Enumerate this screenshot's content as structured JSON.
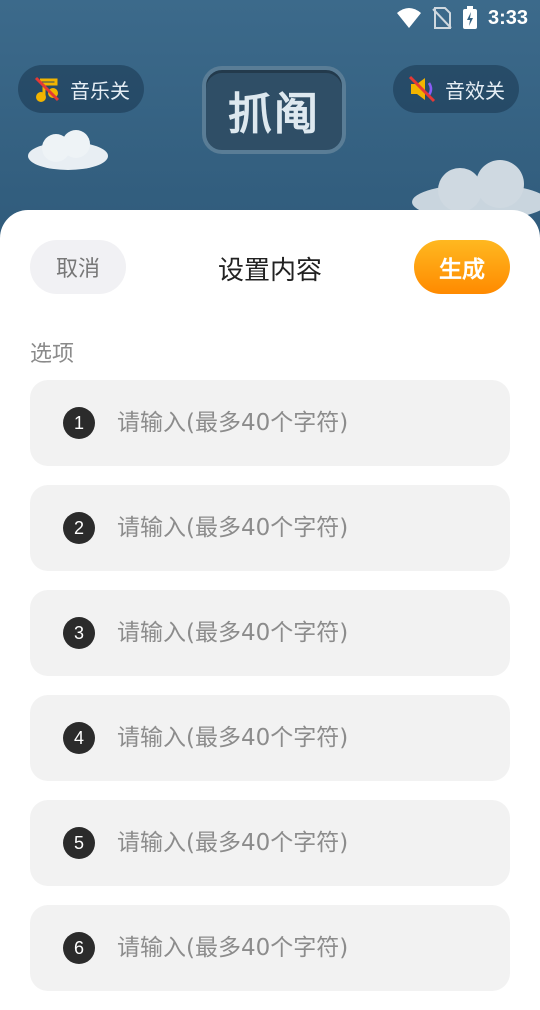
{
  "status_bar": {
    "time": "3:33",
    "icons": [
      "wifi-icon",
      "no-sim-icon",
      "battery-charging-icon"
    ]
  },
  "header": {
    "music_toggle": {
      "label": "音乐关",
      "icon": "music-off-icon"
    },
    "sound_toggle": {
      "label": "音效关",
      "icon": "sound-off-icon"
    },
    "logo_text": "抓阄"
  },
  "sheet": {
    "cancel_label": "取消",
    "title": "设置内容",
    "generate_label": "生成",
    "section_label": "选项",
    "options": [
      {
        "number": "1",
        "placeholder": "请输入(最多40个字符)",
        "value": ""
      },
      {
        "number": "2",
        "placeholder": "请输入(最多40个字符)",
        "value": ""
      },
      {
        "number": "3",
        "placeholder": "请输入(最多40个字符)",
        "value": ""
      },
      {
        "number": "4",
        "placeholder": "请输入(最多40个字符)",
        "value": ""
      },
      {
        "number": "5",
        "placeholder": "请输入(最多40个字符)",
        "value": ""
      },
      {
        "number": "6",
        "placeholder": "请输入(最多40个字符)",
        "value": ""
      }
    ]
  },
  "colors": {
    "background": "#356282",
    "accent": "#ff9a10",
    "option_bg": "#f2f2f2",
    "number_badge": "#2b2b2b"
  }
}
